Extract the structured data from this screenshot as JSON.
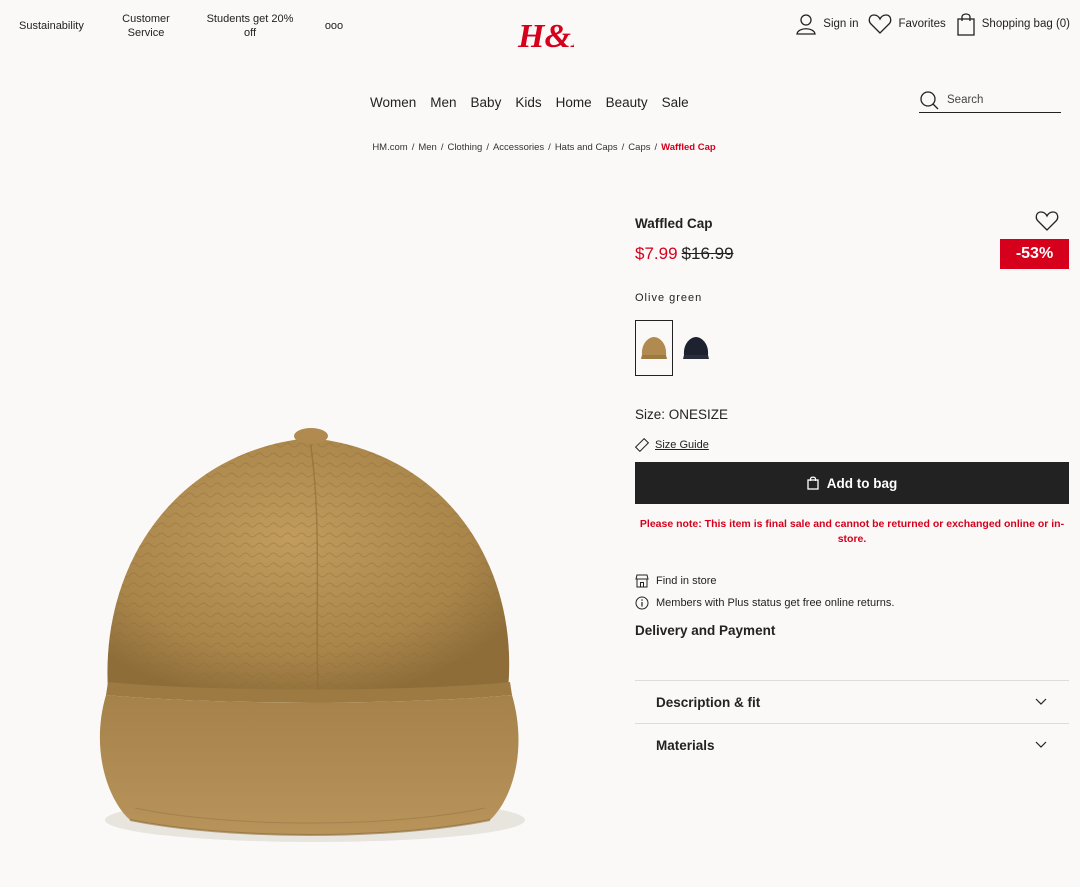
{
  "top_links": {
    "sustainability": "Sustainability",
    "customer_service": "Customer Service",
    "students": "Students get 20% off",
    "more": "ooo"
  },
  "logo": {
    "text": "H&M"
  },
  "account": {
    "sign_in": "Sign in",
    "favorites": "Favorites",
    "bag": "Shopping bag (0)"
  },
  "main_nav": [
    "Women",
    "Men",
    "Baby",
    "Kids",
    "Home",
    "Beauty",
    "Sale"
  ],
  "search": {
    "placeholder": "Search"
  },
  "breadcrumb": {
    "items": [
      "HM.com",
      "Men",
      "Clothing",
      "Accessories",
      "Hats and Caps",
      "Caps"
    ],
    "current": "Waffled Cap"
  },
  "product": {
    "title": "Waffled Cap",
    "price_now": "$7.99",
    "price_old": "$16.99",
    "discount": "-53%",
    "color_name": "Olive green",
    "swatches": [
      {
        "name": "Olive green",
        "color": "#b08a4e",
        "selected": true
      },
      {
        "name": "Black",
        "color": "#1e2230",
        "selected": false
      }
    ],
    "size": "Size: ONESIZE",
    "size_guide": "Size Guide",
    "add_to_bag": "Add to bag",
    "note": "Please note: This item is final sale and cannot be returned or exchanged online or in-store.",
    "find_in_store": "Find in store",
    "members": "Members with Plus status get free online returns.",
    "delivery": "Delivery and Payment",
    "accordions": [
      "Description & fit",
      "Materials"
    ]
  },
  "colors": {
    "accent_red": "#d6001c",
    "dark": "#222222",
    "cap": "#b08a4e"
  }
}
